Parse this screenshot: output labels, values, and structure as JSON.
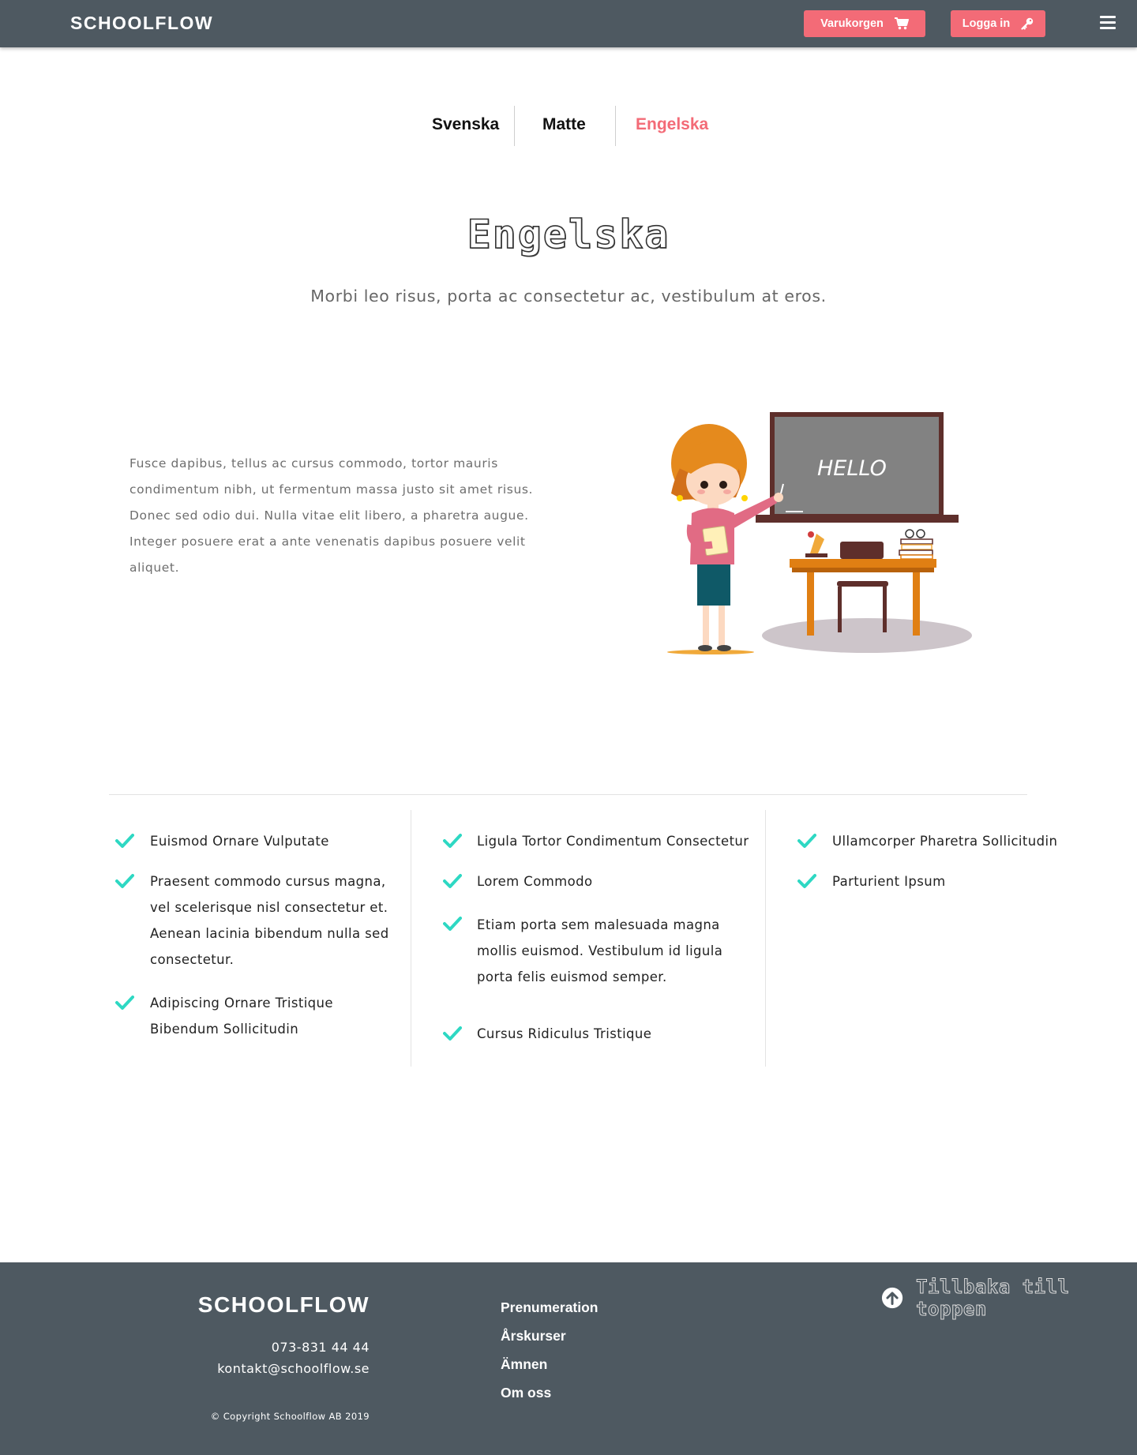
{
  "header": {
    "logo": "SCHOOLFLOW",
    "cart_label": "Varukorgen",
    "login_label": "Logga in"
  },
  "tabs": [
    {
      "label": "Svenska",
      "active": false
    },
    {
      "label": "Matte",
      "active": false
    },
    {
      "label": "Engelska",
      "active": true
    }
  ],
  "hero": {
    "title": "Engelska",
    "subtitle": "Morbi leo risus, porta ac consectetur ac, vestibulum at eros.",
    "intro": "Fusce dapibus, tellus ac cursus commodo, tortor mauris condimentum nibh, ut fermentum massa justo sit amet risus. Donec sed odio dui. Nulla vitae elit libero, a pharetra augue. Integer posuere erat a ante venenatis dapibus posuere velit aliquet."
  },
  "illustration": {
    "chalkboard_text": "HELLO",
    "icon": "teacher-at-chalkboard-illustration"
  },
  "features": {
    "columns": [
      [
        "Euismod Ornare Vulputate",
        "Praesent commodo cursus magna, vel scelerisque nisl consectetur et. Aenean lacinia bibendum nulla sed consectetur.",
        "Adipiscing Ornare Tristique Bibendum Sollicitudin"
      ],
      [
        "Ligula Tortor Condimentum Consectetur",
        "Lorem Commodo",
        "Etiam porta sem malesuada magna mollis euismod. Vestibulum id ligula porta felis euismod semper.",
        "Cursus Ridiculus Tristique"
      ],
      [
        "Ullamcorper Pharetra Sollicitudin",
        "Parturient Ipsum"
      ]
    ],
    "check_icon": "check-icon"
  },
  "footer": {
    "logo": "SCHOOLFLOW",
    "phone": "073-831 44 44",
    "email": "kontakt@schoolflow.se",
    "copyright": "© Copyright Schoolflow AB 2019",
    "links": [
      "Prenumeration",
      "Årskurser",
      "Ämnen",
      "Om oss"
    ],
    "back_to_top": "Tillbaka till toppen"
  },
  "colors": {
    "header_bg": "#4e5961",
    "accent": "#f36b77",
    "check": "#2ed8c3",
    "footer_bg": "#4e5961"
  }
}
